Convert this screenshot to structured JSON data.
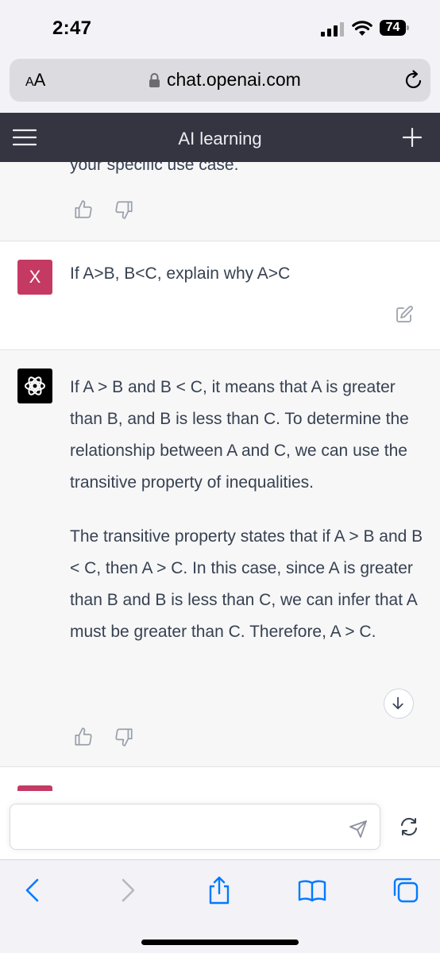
{
  "status_bar": {
    "time": "2:47",
    "battery_level": "74"
  },
  "browser": {
    "text_size_label_small": "A",
    "text_size_label_large": "A",
    "url": "chat.openai.com"
  },
  "app_header": {
    "title": "AI learning"
  },
  "conversation": {
    "previous_message_tail": "your specific use case.",
    "user_message": {
      "avatar_initial": "X",
      "text": "If A>B, B<C, explain why A>C"
    },
    "assistant_message": {
      "paragraphs": [
        "If A > B and B < C, it means that A is greater than B, and B is less than C. To determine the relationship between A and C, we can use the transitive property of inequalities.",
        "The transitive property states that if A > B and B < C, then A > C. In this case, since A is greater than B and B is less than C, we can infer that A must be greater than C. Therefore, A > C."
      ]
    }
  },
  "composer": {
    "placeholder": "",
    "value": ""
  },
  "colors": {
    "header_bg": "#343541",
    "user_avatar": "#c43a63",
    "assistant_avatar": "#000000",
    "ios_accent": "#007aff",
    "message_bg_alt": "#f7f7f8"
  },
  "icons": {
    "status": [
      "signal-icon",
      "wifi-icon",
      "battery-icon"
    ],
    "browser": [
      "lock-icon",
      "reload-icon"
    ],
    "header": [
      "menu-icon",
      "new-chat-icon"
    ],
    "message_actions": [
      "thumbs-up-icon",
      "thumbs-down-icon",
      "edit-icon",
      "scroll-down-icon"
    ],
    "composer": [
      "send-icon",
      "regenerate-icon"
    ],
    "toolbar": [
      "back-icon",
      "forward-icon",
      "share-icon",
      "bookmarks-icon",
      "tabs-icon"
    ]
  }
}
